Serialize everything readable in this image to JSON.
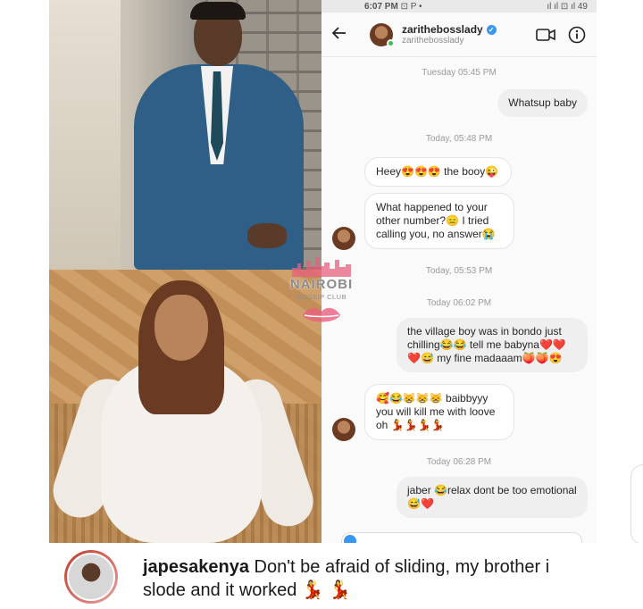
{
  "status_bar": {
    "time": "6:07 PM",
    "indicators": "⊡ P •",
    "right": "ıl ıl ⊡ ıl 49"
  },
  "chat_header": {
    "username": "zarithebosslady",
    "handle": "zarithebosslady",
    "verified": true,
    "icons": [
      "back-arrow-icon",
      "video-camera-icon",
      "info-icon"
    ]
  },
  "messages": [
    {
      "kind": "timestamp",
      "text": "Tuesday 05:45 PM"
    },
    {
      "kind": "outgoing",
      "text": "Whatsup baby"
    },
    {
      "kind": "timestamp",
      "text": "Today, 05:48 PM"
    },
    {
      "kind": "incoming",
      "text": "Heey😍😍😍 the booy😜"
    },
    {
      "kind": "incoming",
      "text": "What happened to your other number?😑 I tried calling you, no answer😭"
    },
    {
      "kind": "timestamp",
      "text": "Today, 05:53 PM"
    },
    {
      "kind": "timestamp",
      "text": "Today 06:02 PM"
    },
    {
      "kind": "outgoing",
      "text": "the village boy was in bondo just chilling😂😂 tell me babyna❤️❤️❤️😅 my fine madaaam🍑🍑😍"
    },
    {
      "kind": "incoming",
      "text": "🥰😂😸😸😸 baibbyyy you will kill me with loove oh 💃💃💃💃"
    },
    {
      "kind": "timestamp",
      "text": "Today 06:28 PM"
    },
    {
      "kind": "outgoing",
      "text": "jaber 😂relax dont be too emotional😅❤️"
    }
  ],
  "watermark": {
    "title": "NAIROBI",
    "subtitle": "GOSSIP CLUB"
  },
  "comment": {
    "username": "japesakenya",
    "text": "Don't be afraid of sliding, my brother i slode and it worked 💃 💃"
  }
}
